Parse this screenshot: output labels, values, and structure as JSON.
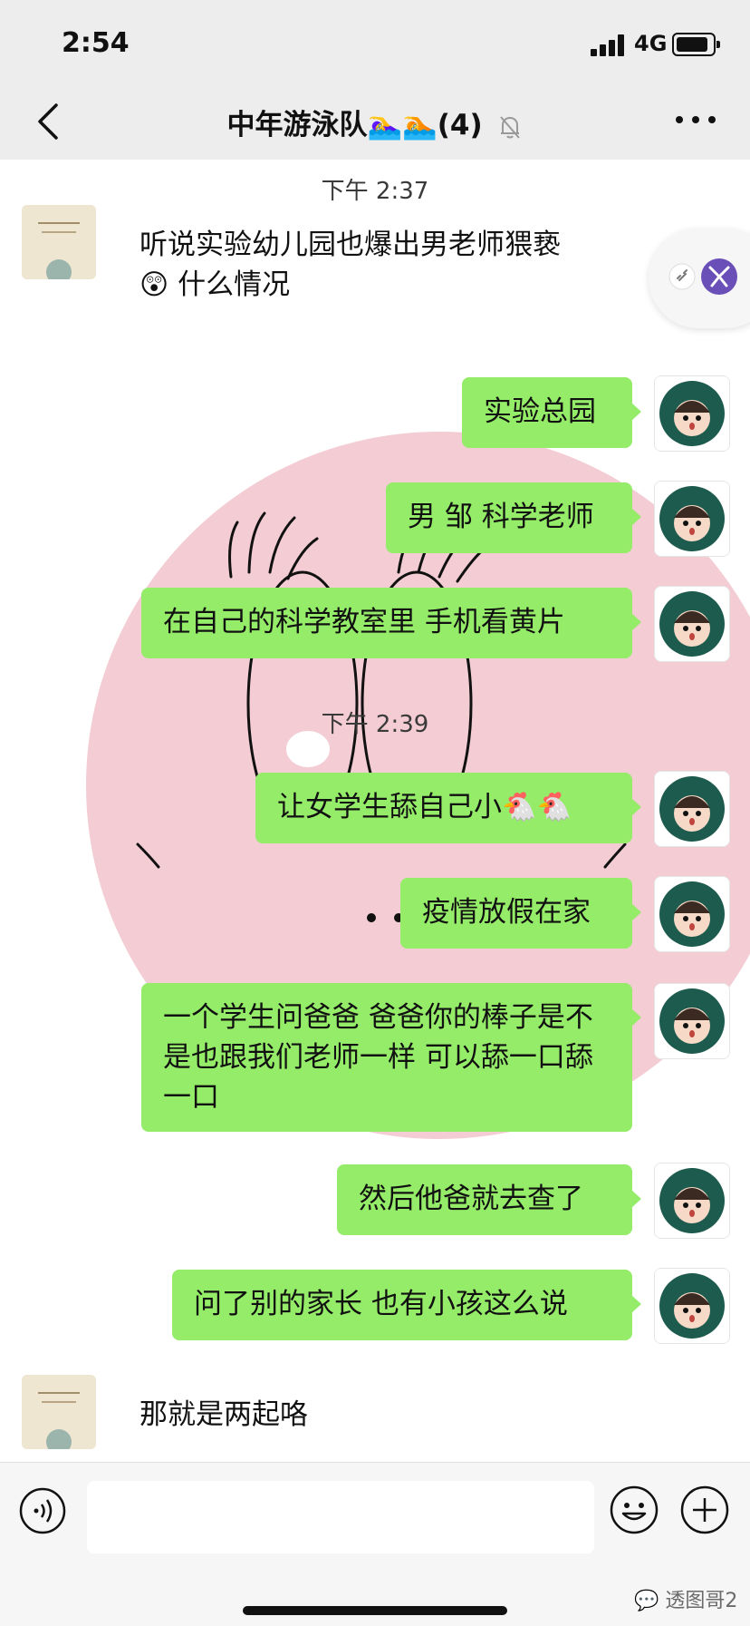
{
  "status_bar": {
    "time": "2:54",
    "network": "4G"
  },
  "nav": {
    "title": "中年游泳队🏊‍♀️🏊(4)"
  },
  "messages": {
    "timestamp_1": "下午 2:37",
    "left_1": "听说实验幼儿园也爆出男老师猥亵",
    "left_1_line2": "😲 什么情况",
    "right_1": "实验总园",
    "right_2": "男 邹 科学老师",
    "right_3": "在自己的科学教室里 手机看黄片",
    "timestamp_2": "下午 2:39",
    "right_4": "让女学生舔自己小🐔🐔",
    "right_5": "疫情放假在家",
    "right_6": "一个学生问爸爸 爸爸你的棒子是不是也跟我们老师一样 可以舔一口舔一口",
    "right_7": "然后他爸就去查了",
    "right_8": "问了别的家长 也有小孩这么说",
    "left_2": "那就是两起咯"
  },
  "watermark": "透图哥2",
  "icons": {
    "back": "chevron-left-icon",
    "mute": "bell-slash-icon",
    "more": "more-dots-icon",
    "voice": "voice-icon",
    "emoji": "smiley-icon",
    "plus": "plus-icon",
    "link": "link-icon",
    "butterfly": "butterfly-icon"
  },
  "colors": {
    "bubble_green": "#95ec69",
    "header_bg": "#ededed",
    "background_circle": "#f3ccd4"
  }
}
